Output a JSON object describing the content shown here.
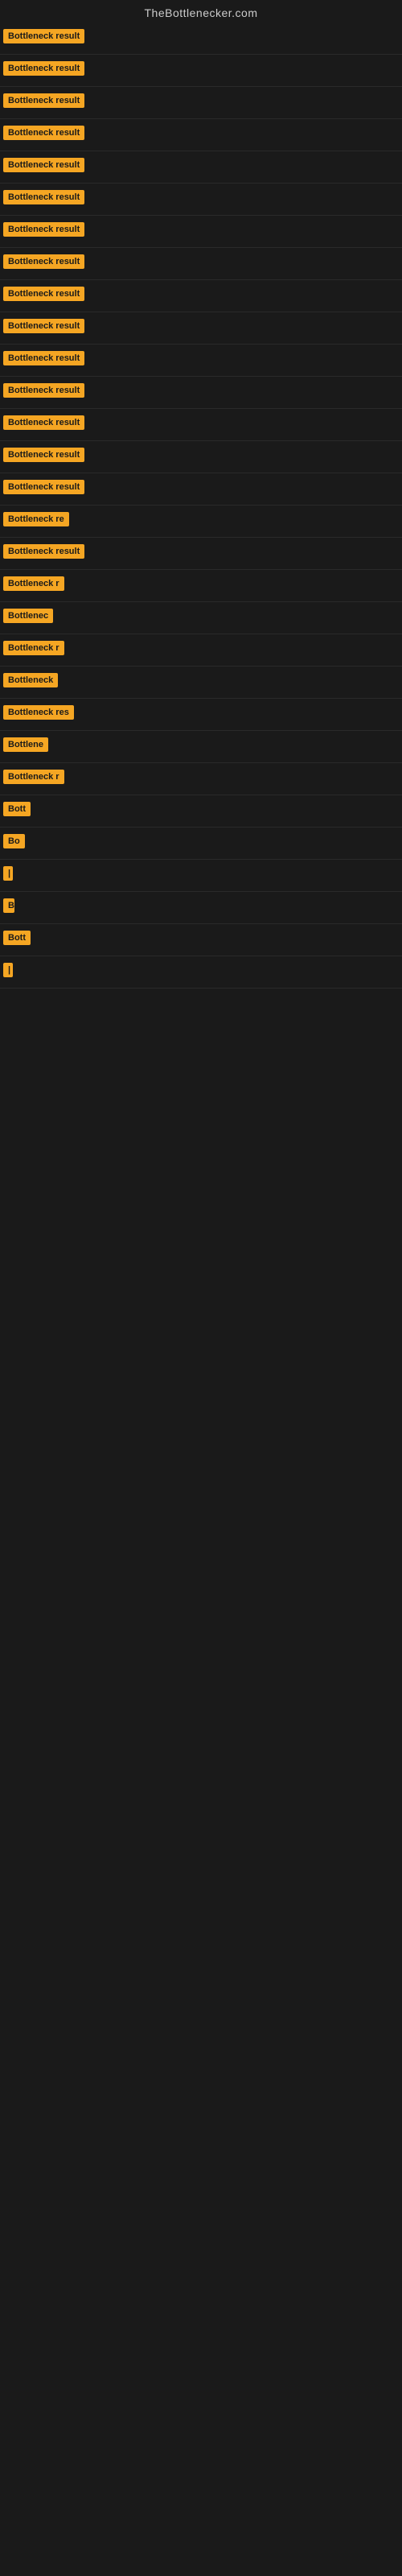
{
  "site": {
    "title": "TheBottlenecker.com"
  },
  "items": [
    {
      "label": "Bottleneck result",
      "width": 120
    },
    {
      "label": "Bottleneck result",
      "width": 120
    },
    {
      "label": "Bottleneck result",
      "width": 120
    },
    {
      "label": "Bottleneck result",
      "width": 115
    },
    {
      "label": "Bottleneck result",
      "width": 120
    },
    {
      "label": "Bottleneck result",
      "width": 118
    },
    {
      "label": "Bottleneck result",
      "width": 120
    },
    {
      "label": "Bottleneck result",
      "width": 120
    },
    {
      "label": "Bottleneck result",
      "width": 118
    },
    {
      "label": "Bottleneck result",
      "width": 116
    },
    {
      "label": "Bottleneck result",
      "width": 120
    },
    {
      "label": "Bottleneck result",
      "width": 114
    },
    {
      "label": "Bottleneck result",
      "width": 112
    },
    {
      "label": "Bottleneck result",
      "width": 112
    },
    {
      "label": "Bottleneck result",
      "width": 110
    },
    {
      "label": "Bottleneck re",
      "width": 95
    },
    {
      "label": "Bottleneck result",
      "width": 108
    },
    {
      "label": "Bottleneck r",
      "width": 88
    },
    {
      "label": "Bottlenec",
      "width": 78
    },
    {
      "label": "Bottleneck r",
      "width": 85
    },
    {
      "label": "Bottleneck",
      "width": 80
    },
    {
      "label": "Bottleneck res",
      "width": 98
    },
    {
      "label": "Bottlene",
      "width": 72
    },
    {
      "label": "Bottleneck r",
      "width": 84
    },
    {
      "label": "Bott",
      "width": 42
    },
    {
      "label": "Bo",
      "width": 28
    },
    {
      "label": "|",
      "width": 8
    },
    {
      "label": "B",
      "width": 14
    },
    {
      "label": "Bott",
      "width": 42
    },
    {
      "label": "|",
      "width": 6
    }
  ]
}
